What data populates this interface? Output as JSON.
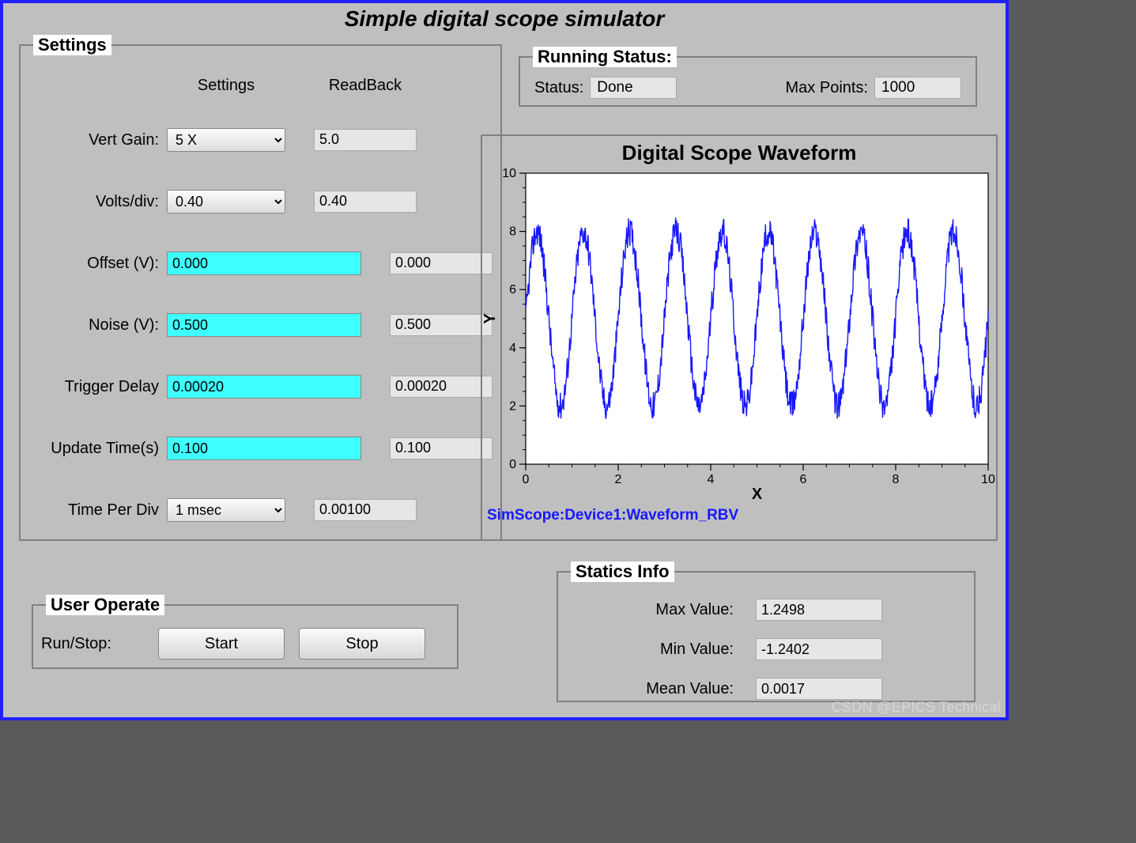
{
  "title": "Simple digital scope simulator",
  "settings": {
    "legend": "Settings",
    "col_settings": "Settings",
    "col_readback": "ReadBack",
    "rows": [
      {
        "label": "Vert Gain:",
        "type": "select",
        "value": "5 X",
        "readback": "5.0"
      },
      {
        "label": "Volts/div:",
        "type": "select",
        "value": "0.40",
        "readback": "0.40"
      },
      {
        "label": "Offset (V):",
        "type": "input",
        "value": "0.000",
        "readback": "0.000"
      },
      {
        "label": "Noise (V):",
        "type": "input",
        "value": "0.500",
        "readback": "0.500"
      },
      {
        "label": "Trigger Delay",
        "type": "input",
        "value": "0.00020",
        "readback": "0.00020"
      },
      {
        "label": "Update Time(s)",
        "type": "input",
        "value": "0.100",
        "readback": "0.100"
      },
      {
        "label": "Time Per Div",
        "type": "select",
        "value": "1 msec",
        "readback": "0.00100"
      }
    ]
  },
  "status": {
    "legend": "Running Status:",
    "status_label": "Status:",
    "status_value": "Done",
    "maxpoints_label": "Max Points:",
    "maxpoints_value": "1000"
  },
  "waveform": {
    "title": "Digital Scope Waveform",
    "pv": "SimScope:Device1:Waveform_RBV"
  },
  "operate": {
    "legend": "User Operate",
    "label": "Run/Stop:",
    "start": "Start",
    "stop": "Stop"
  },
  "stats": {
    "legend": "Statics Info",
    "rows": [
      {
        "label": "Max Value:",
        "value": "1.2498"
      },
      {
        "label": "Min Value:",
        "value": "-1.2402"
      },
      {
        "label": "Mean Value:",
        "value": "0.0017"
      }
    ]
  },
  "watermark": "CSDN @EPICS Technical",
  "chart_data": {
    "type": "line",
    "title": "Digital Scope Waveform",
    "xlabel": "X",
    "ylabel": "Y",
    "xlim": [
      0,
      10
    ],
    "ylim": [
      0,
      10
    ],
    "xticks": [
      0,
      2,
      4,
      6,
      8,
      10
    ],
    "yticks": [
      0,
      2,
      4,
      6,
      8,
      10
    ],
    "description": "Noisy sine-like waveform, ~10 cycles across x=0..10, amplitude approx 2..8 (center ~5, peak-to-peak ~6), noise amplitude ~0.5",
    "series": [
      {
        "name": "Waveform_RBV",
        "color": "#1818ff",
        "center": 5.0,
        "amplitude": 3.0,
        "noise": 0.5,
        "cycles": 10,
        "points": 1000,
        "y_range_observed": [
          2,
          8
        ]
      }
    ]
  }
}
